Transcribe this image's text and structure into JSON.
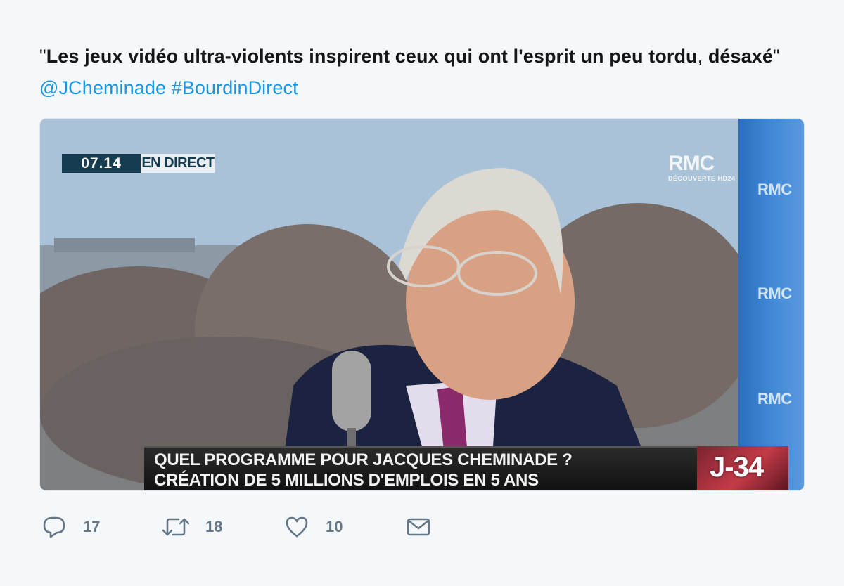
{
  "tweet": {
    "text_quote_open": "\"",
    "text_bold": "Les jeux vidéo ultra-violents inspirent ceux qui ont l'esprit un peu tordu",
    "text_comma": ", ",
    "text_bold_2": "désaxé",
    "text_quote_close": "\" ",
    "mention": "@JCheminade",
    "hashtag": "#BourdinDirect",
    "link_color": "#1b95e0"
  },
  "media": {
    "live_time": "07.14",
    "live_label": "EN DIRECT",
    "channel_logo": "RMC",
    "channel_sub": "DÉCOUVERTE HD24",
    "side_logos": [
      "RMC",
      "RMC",
      "RMC"
    ],
    "lower_third_line1": "QUEL PROGRAMME POUR JACQUES CHEMINADE ?",
    "lower_third_line2": "CRÉATION DE 5 MILLIONS D'EMPLOIS EN 5 ANS",
    "countdown": "J-34"
  },
  "actions": {
    "reply": {
      "icon": "reply-icon",
      "count": "17"
    },
    "retweet": {
      "icon": "retweet-icon",
      "count": "18"
    },
    "like": {
      "icon": "heart-icon",
      "count": "10"
    },
    "message": {
      "icon": "envelope-icon"
    }
  },
  "colors": {
    "background": "#f5f8fa",
    "text": "#14171a",
    "action": "#657786"
  }
}
